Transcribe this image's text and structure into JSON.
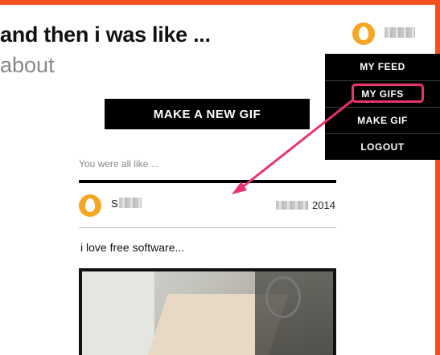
{
  "header": {
    "title": "and then i was like ...",
    "subtitle": "about"
  },
  "user_menu": {
    "items": [
      "MY FEED",
      "MY GIFS",
      "MAKE GIF",
      "LOGOUT"
    ],
    "highlighted_item": "MY GIFS"
  },
  "actions": {
    "make_gif_label": "MAKE A NEW GIF"
  },
  "post": {
    "caption": "You were all like ...",
    "author_initial": "S",
    "date_suffix": "2014",
    "text": "i love free software..."
  },
  "colors": {
    "accent": "#f4511e",
    "avatar": "#f5a623",
    "highlight": "#e8336f"
  },
  "icons": {
    "avatar": "egg-avatar-icon",
    "annotation": "arrow-icon"
  }
}
